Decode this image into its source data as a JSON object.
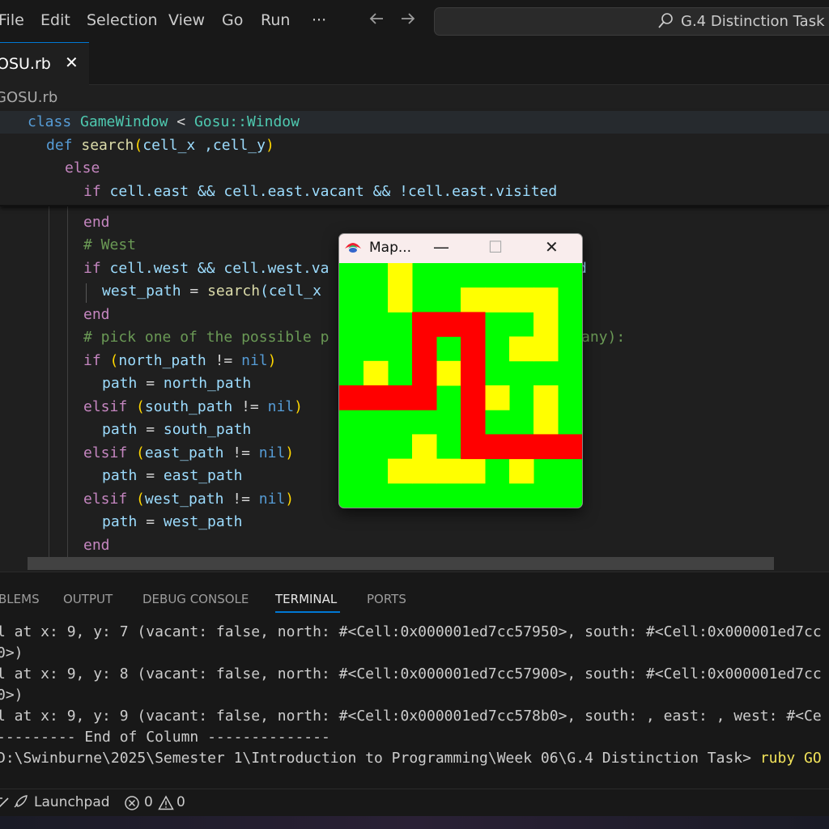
{
  "menu": {
    "items": [
      "File",
      "Edit",
      "Selection",
      "View",
      "Go",
      "Run",
      "···"
    ],
    "back_icon": "arrow-left-icon",
    "forward_icon": "arrow-right-icon"
  },
  "search": {
    "text": "G.4 Distinction Task",
    "icon": "search-icon"
  },
  "tab": {
    "label": "OSU.rb",
    "close": "✕"
  },
  "breadcrumb": "GOSU.rb",
  "sticky": {
    "line1": {
      "kw": "class",
      "name": "GameWindow",
      "op": "<",
      "parent": "Gosu::Window"
    },
    "line2": {
      "kw": "def",
      "name": "search",
      "params": "cell_x ,cell_y"
    },
    "line3": {
      "kw": "else"
    },
    "line4": {
      "kw": "if",
      "rest": "cell.east && cell.east.vacant && !cell.east.visited"
    }
  },
  "code": {
    "l1": {
      "kw": "end"
    },
    "l2": {
      "comment": "# West"
    },
    "l3": {
      "kw": "if",
      "text": "cell.west && cell.west.va",
      "tail": "d"
    },
    "l4": {
      "var": "west_path",
      "op": " = ",
      "fn": "search",
      "args": "(cell_x"
    },
    "l5": {
      "kw": "end"
    },
    "l6": {
      "comment": "# pick one of the possible p",
      "comment_tail": "any):"
    },
    "l7": {
      "kw": "if",
      "open": "(",
      "var": "north_path",
      "op": " != ",
      "nil": "nil",
      "close": ")"
    },
    "l8": {
      "var": "path",
      "op": " = ",
      "val": "north_path"
    },
    "l9": {
      "kw": "elsif",
      "open": "(",
      "var": "south_path",
      "op": " != ",
      "nil": "nil",
      "close": ")"
    },
    "l10": {
      "var": "path",
      "op": " = ",
      "val": "south_path"
    },
    "l11": {
      "kw": "elsif",
      "open": "(",
      "var": "east_path",
      "op": " != ",
      "nil": "nil",
      "close": ")"
    },
    "l12": {
      "var": "path",
      "op": " = ",
      "val": "east_path"
    },
    "l13": {
      "kw": "elsif",
      "open": "(",
      "var": "west_path",
      "op": " != ",
      "nil": "nil",
      "close": ")"
    },
    "l14": {
      "var": "path",
      "op": " = ",
      "val": "west_path"
    },
    "l15": {
      "kw": "end"
    }
  },
  "panel": {
    "tabs": [
      "BLEMS",
      "OUTPUT",
      "DEBUG CONSOLE",
      "TERMINAL",
      "PORTS"
    ],
    "active_tab": "TERMINAL",
    "lines": [
      "l at x: 9, y: 7 (vacant: false, north: #<Cell:0x000001ed7cc57950>, south: #<Cell:0x000001ed7cc",
      "0>)",
      "l at x: 9, y: 8 (vacant: false, north: #<Cell:0x000001ed7cc57900>, south: #<Cell:0x000001ed7cc",
      "0>)",
      "l at x: 9, y: 9 (vacant: false, north: #<Cell:0x000001ed7cc578b0>, south: , east: , west: #<Ce",
      "--------- End of Column --------------"
    ],
    "prompt": "D:\\Swinburne\\2025\\Semester 1\\Introduction to Programming\\Week 06\\G.4 Distinction Task> ",
    "command": "ruby GO"
  },
  "status": {
    "launchpad": "Launchpad",
    "errors": "0",
    "warnings": "0"
  },
  "popup": {
    "title": "Map...",
    "minimize": "—",
    "maximize": "☐",
    "close": "✕",
    "colors": {
      "background": "#00ff00",
      "wall": "#ffff00",
      "path": "#ff0000"
    },
    "grid_size": 10,
    "yellow_cells": [
      [
        2,
        0
      ],
      [
        2,
        1
      ],
      [
        5,
        1
      ],
      [
        6,
        1
      ],
      [
        7,
        1
      ],
      [
        8,
        1
      ],
      [
        8,
        2
      ],
      [
        7,
        3
      ],
      [
        8,
        3
      ],
      [
        1,
        4
      ],
      [
        4,
        4
      ],
      [
        6,
        5
      ],
      [
        8,
        5
      ],
      [
        8,
        6
      ],
      [
        3,
        7
      ],
      [
        2,
        8
      ],
      [
        3,
        8
      ],
      [
        4,
        8
      ],
      [
        5,
        8
      ],
      [
        7,
        8
      ]
    ],
    "red_cells": [
      [
        3,
        2
      ],
      [
        4,
        2
      ],
      [
        5,
        2
      ],
      [
        3,
        3
      ],
      [
        5,
        3
      ],
      [
        3,
        4
      ],
      [
        5,
        4
      ],
      [
        0,
        5
      ],
      [
        1,
        5
      ],
      [
        2,
        5
      ],
      [
        3,
        5
      ],
      [
        5,
        5
      ],
      [
        5,
        6
      ],
      [
        5,
        7
      ],
      [
        6,
        7
      ],
      [
        7,
        7
      ],
      [
        8,
        7
      ],
      [
        9,
        7
      ]
    ]
  }
}
